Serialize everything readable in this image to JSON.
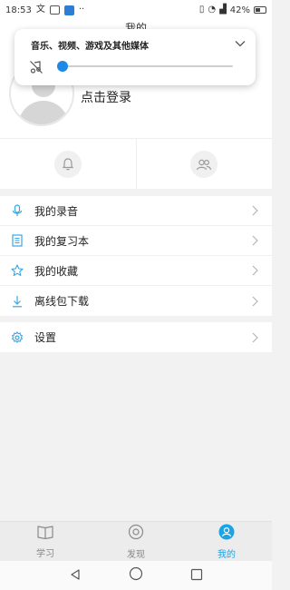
{
  "status_bar": {
    "time": "18:53",
    "battery": "42%"
  },
  "header": {
    "title": "我的"
  },
  "volume_panel": {
    "title": "音乐、视频、游戏及其他媒体",
    "level": 0.0
  },
  "profile": {
    "login_label": "点击登录"
  },
  "menu": {
    "items": [
      {
        "label": "我的录音",
        "icon": "microphone-icon"
      },
      {
        "label": "我的复习本",
        "icon": "notebook-icon"
      },
      {
        "label": "我的收藏",
        "icon": "star-icon"
      },
      {
        "label": "离线包下载",
        "icon": "download-icon"
      }
    ],
    "settings": {
      "label": "设置",
      "icon": "gear-icon"
    }
  },
  "bottom_nav": {
    "tabs": [
      {
        "label": "学习",
        "icon": "book-icon",
        "active": false
      },
      {
        "label": "发现",
        "icon": "discover-icon",
        "active": false
      },
      {
        "label": "我的",
        "icon": "user-icon",
        "active": true
      }
    ]
  },
  "colors": {
    "accent": "#1ba3e5",
    "volume_thumb": "#1e88e5",
    "icon_blue": "#3aa6e0"
  }
}
